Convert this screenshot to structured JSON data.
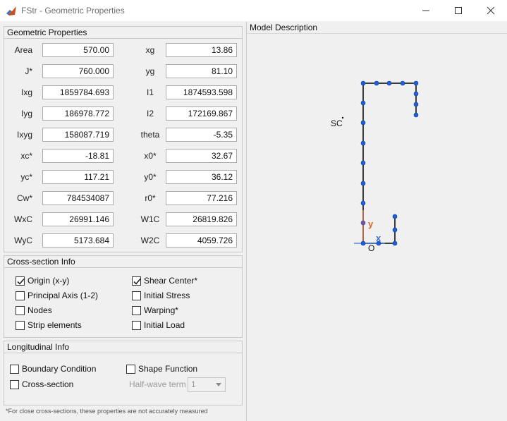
{
  "window": {
    "title": "FStr - Geometric Properties",
    "minimize": "—",
    "maximize": "☐",
    "close": "✕"
  },
  "geometric": {
    "title": "Geometric Properties",
    "left": [
      {
        "label": "Area",
        "value": "570.00"
      },
      {
        "label": "J*",
        "value": "760.000"
      },
      {
        "label": "Ixg",
        "value": "1859784.693"
      },
      {
        "label": "Iyg",
        "value": "186978.772"
      },
      {
        "label": "Ixyg",
        "value": "158087.719"
      },
      {
        "label": "xc*",
        "value": "-18.81"
      },
      {
        "label": "yc*",
        "value": "117.21"
      },
      {
        "label": "Cw*",
        "value": "784534087"
      },
      {
        "label": "WxC",
        "value": "26991.146"
      },
      {
        "label": "WyC",
        "value": "5173.684"
      }
    ],
    "right": [
      {
        "label": "xg",
        "value": "13.86"
      },
      {
        "label": "yg",
        "value": "81.10"
      },
      {
        "label": "I1",
        "value": "1874593.598"
      },
      {
        "label": "I2",
        "value": "172169.867"
      },
      {
        "label": "theta",
        "value": "-5.35"
      },
      {
        "label": "x0*",
        "value": "32.67"
      },
      {
        "label": "y0*",
        "value": "36.12"
      },
      {
        "label": "r0*",
        "value": "77.216"
      },
      {
        "label": "W1C",
        "value": "26819.826"
      },
      {
        "label": "W2C",
        "value": "4059.726"
      }
    ]
  },
  "cross_section": {
    "title": "Cross-section Info",
    "options": [
      {
        "label": "Origin (x-y)",
        "checked": true
      },
      {
        "label": "Shear Center*",
        "checked": true
      },
      {
        "label": "Principal Axis (1-2)",
        "checked": false
      },
      {
        "label": "Initial Stress",
        "checked": false
      },
      {
        "label": "Nodes",
        "checked": false
      },
      {
        "label": "Warping*",
        "checked": false
      },
      {
        "label": "Strip elements",
        "checked": false
      },
      {
        "label": "Initial Load",
        "checked": false
      }
    ]
  },
  "longitudinal": {
    "title": "Longitudinal Info",
    "options": [
      {
        "label": "Boundary Condition",
        "checked": false
      },
      {
        "label": "Shape Function",
        "checked": false
      },
      {
        "label": "Cross-section",
        "checked": false
      }
    ],
    "halfwave_label": "Half-wave term",
    "halfwave_value": "1"
  },
  "footnote": "*For close cross-sections, these properties are not accurately measured",
  "model": {
    "title": "Model Description",
    "sc_label": "SC",
    "origin_label": "O",
    "x_label": "x",
    "y_label": "y",
    "line_color": "#000000",
    "node_color": "#1f5fd6",
    "x_axis_color": "#3a6fd6",
    "y_axis_color": "#d4622a"
  }
}
